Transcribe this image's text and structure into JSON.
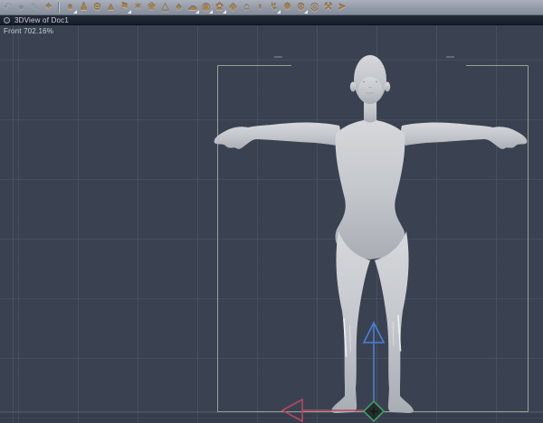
{
  "window": {
    "title": "3DView of Doc1"
  },
  "viewport": {
    "camera": "Front",
    "zoom": "702.16%"
  },
  "toolbar": {
    "icons": [
      {
        "name": "undo-icon",
        "glyph": "↶",
        "disabled": true,
        "dropdown": false
      },
      {
        "name": "history-icon",
        "glyph": "●",
        "disabled": true,
        "dropdown": false
      },
      {
        "name": "pen-icon",
        "glyph": "✎",
        "disabled": true,
        "dropdown": false
      },
      {
        "name": "render-icon",
        "glyph": "✦",
        "disabled": false,
        "dropdown": false
      },
      {
        "separator": true
      },
      {
        "name": "sphere-tool-icon",
        "glyph": "●",
        "disabled": false,
        "dropdown": true
      },
      {
        "name": "figure-tool-icon",
        "glyph": "♟",
        "disabled": false,
        "dropdown": false
      },
      {
        "name": "globe-tool-icon",
        "glyph": "⊕",
        "disabled": false,
        "dropdown": false
      },
      {
        "name": "cone-tool-icon",
        "glyph": "▲",
        "disabled": false,
        "dropdown": false
      },
      {
        "name": "camera-tool-icon",
        "glyph": "⚑",
        "disabled": false,
        "dropdown": true
      },
      {
        "name": "deformer-tool-icon",
        "glyph": "✶",
        "disabled": false,
        "dropdown": false
      },
      {
        "name": "flower-tool-icon",
        "glyph": "❀",
        "disabled": false,
        "dropdown": false
      },
      {
        "name": "pyramid-tool-icon",
        "glyph": "△",
        "disabled": false,
        "dropdown": false
      },
      {
        "name": "tree-tool-icon",
        "glyph": "♠",
        "disabled": false,
        "dropdown": false
      },
      {
        "name": "cloud-tool-icon",
        "glyph": "☁",
        "disabled": false,
        "dropdown": true
      },
      {
        "name": "rock-tool-icon",
        "glyph": "◉",
        "disabled": false,
        "dropdown": true
      },
      {
        "name": "blossom-tool-icon",
        "glyph": "✿",
        "disabled": false,
        "dropdown": true
      },
      {
        "name": "gem-tool-icon",
        "glyph": "◈",
        "disabled": false,
        "dropdown": false
      },
      {
        "name": "house-tool-icon",
        "glyph": "⌂",
        "disabled": false,
        "dropdown": false
      },
      {
        "name": "bowl-tool-icon",
        "glyph": "◗",
        "disabled": false,
        "dropdown": false
      },
      {
        "name": "lightning-tool-icon",
        "glyph": "↯",
        "disabled": false,
        "dropdown": true
      },
      {
        "name": "burst-tool-icon",
        "glyph": "✸",
        "disabled": false,
        "dropdown": false
      },
      {
        "name": "molecule-tool-icon",
        "glyph": "⊗",
        "disabled": false,
        "dropdown": true
      },
      {
        "name": "target-tool-icon",
        "glyph": "◎",
        "disabled": false,
        "dropdown": false
      },
      {
        "name": "hammer-tool-icon",
        "glyph": "⚒",
        "disabled": false,
        "dropdown": false
      },
      {
        "name": "pipe-tool-icon",
        "glyph": "➤",
        "disabled": false,
        "dropdown": false
      }
    ]
  },
  "colors": {
    "toolbar_bg": "#9aa1ad",
    "title_bar_bg": "#1a212d",
    "viewport_bg": "#3a4252",
    "selection_frame": "#a3ad97",
    "axis_x_red": "#b5485f",
    "axis_y_blue": "#4a7fd4",
    "gizmo_center_green": "#43996b",
    "figure_gray": "#c6c9cd",
    "icon_gold": "#b98f54"
  }
}
